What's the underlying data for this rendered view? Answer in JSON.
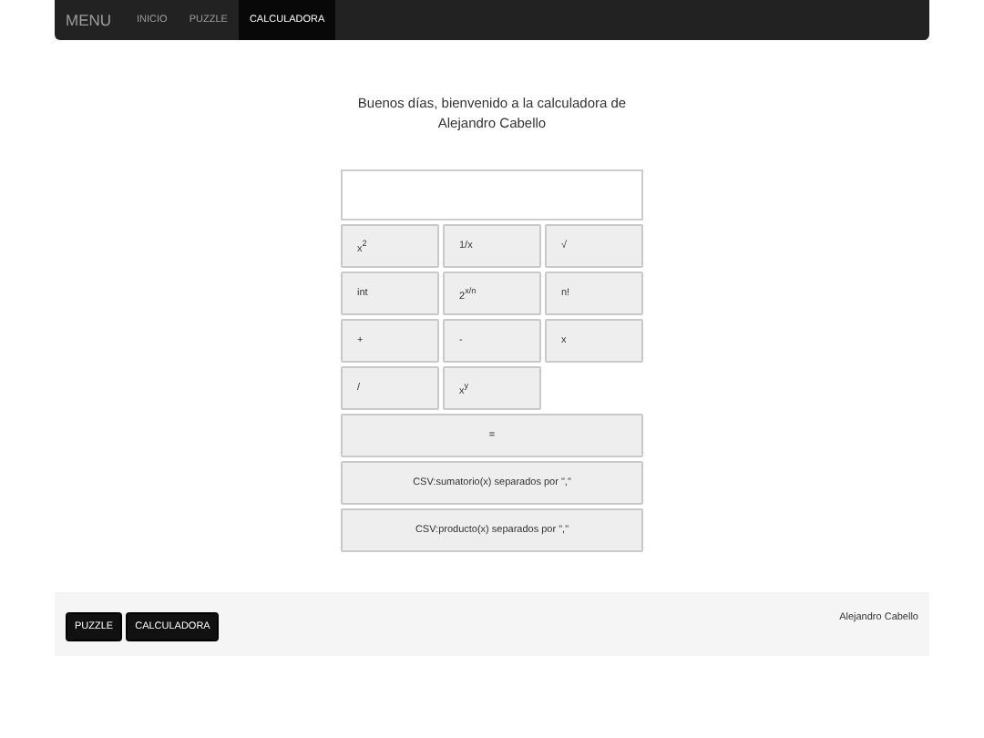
{
  "navbar": {
    "brand": "MENU",
    "items": [
      {
        "label": "INICIO",
        "selected": false
      },
      {
        "label": "PUZZLE",
        "selected": false
      },
      {
        "label": "CALCULADORA",
        "selected": true
      }
    ]
  },
  "greeting": "Buenos días, bienvenido a la calculadora de Alejandro Cabello",
  "keys": [
    "x$^{2}$",
    "1/x",
    "√",
    "int",
    "2$^{x/n}$",
    "n!",
    "+",
    "-",
    "x",
    "/",
    "x$^{y}$"
  ],
  "wide_keys": [
    "=",
    "CSV:sumatorio(x) separados por \",\"",
    "CSV:producto(x) separados por \",\""
  ],
  "footer": {
    "buttons": [
      "PUZZLE",
      "CALCULADORA"
    ],
    "author": "Alejandro Cabello"
  }
}
